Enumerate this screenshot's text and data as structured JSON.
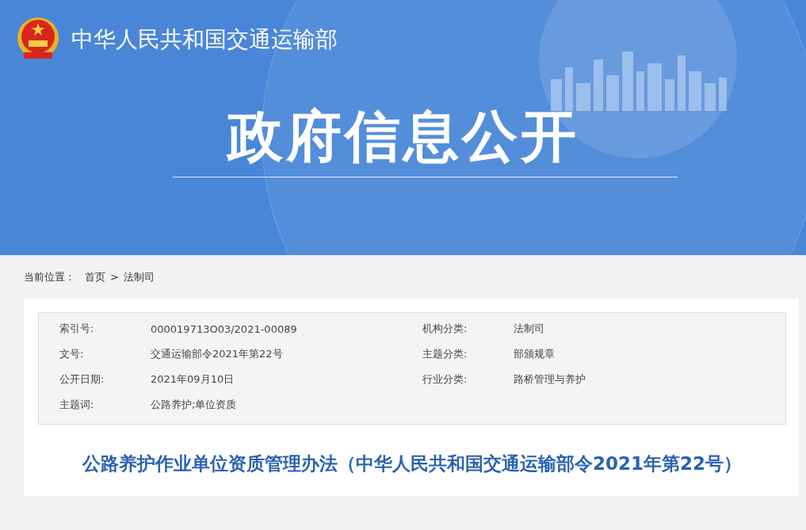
{
  "header": {
    "site_name": "中华人民共和国交通运输部",
    "banner_title": "政府信息公开"
  },
  "breadcrumb": {
    "label": "当前位置：",
    "items": [
      {
        "text": "首页"
      },
      {
        "text": "法制司"
      }
    ],
    "separator": ">"
  },
  "meta_left": [
    {
      "label": "索引号:",
      "value": "000019713O03/2021-00089"
    },
    {
      "label": "文号:",
      "value": "交通运输部令2021年第22号"
    },
    {
      "label": "公开日期:",
      "value": "2021年09月10日"
    },
    {
      "label": "主题词:",
      "value": "公路养护;单位资质"
    }
  ],
  "meta_right": [
    {
      "label": "机构分类:",
      "value": "法制司"
    },
    {
      "label": "主题分类:",
      "value": "部颁规章"
    },
    {
      "label": "行业分类:",
      "value": "路桥管理与养护"
    }
  ],
  "article_title": "公路养护作业单位资质管理办法（中华人民共和国交通运输部令2021年第22号）"
}
